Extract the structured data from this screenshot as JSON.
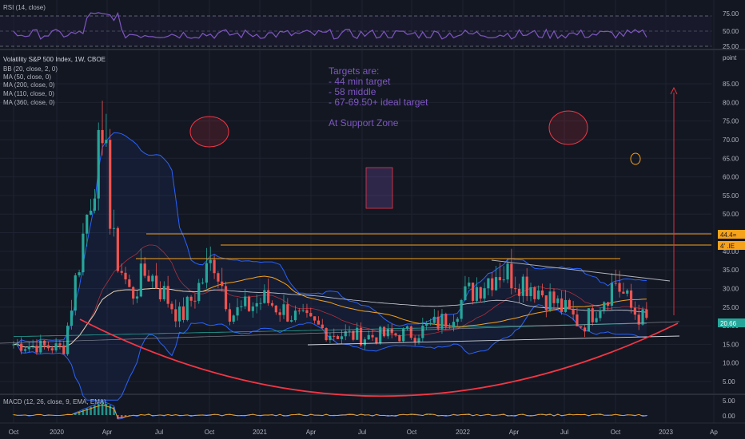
{
  "rsi_pane": {
    "label": "RSI (14, close)",
    "ticks": [
      "75.00",
      "50.00",
      "25.00"
    ]
  },
  "main_pane": {
    "title": "Volatility S&P 500 Index, 1W, CBOE",
    "indicators": [
      "BB (20, close, 2, 0)",
      "MA (50, close, 0)",
      "MA (200, close, 0)",
      "MA (110, close, 0)",
      "MA (360, close, 0)"
    ],
    "unit_label": "point",
    "price_ticks": [
      "85.00",
      "80.00",
      "75.00",
      "70.00",
      "65.00",
      "60.00",
      "55.00",
      "50.00",
      "45.00",
      "40.00",
      "35.00",
      "30.00",
      "25.00",
      "20.00",
      "15.00",
      "10.00",
      "5.00"
    ],
    "level_badges": [
      {
        "text": "44.4=",
        "color": "#f7a21b"
      },
      {
        "text": "4' .IE",
        "color": "#f7a21b"
      },
      {
        "text": "20.66",
        "color": "#26a69a"
      }
    ],
    "annotation": {
      "lines": [
        "Targets are:",
        "- 44 min target",
        "- 58 middle",
        "- 67-69.50+ ideal target",
        "",
        "At Support Zone"
      ],
      "color": "#7e57c2"
    }
  },
  "macd_pane": {
    "label": "MACD (12, 26, close, 9, EMA, EMA)",
    "ticks": [
      "5.00",
      "0.00"
    ]
  },
  "x_axis": {
    "labels": [
      "Oct",
      "2020",
      "Apr",
      "Jul",
      "Oct",
      "2021",
      "Apr",
      "Jul",
      "Oct",
      "2022",
      "Apr",
      "Jul",
      "Oct",
      "2023",
      "Ap"
    ]
  },
  "colors": {
    "background": "#131722",
    "up": "#26a69a",
    "down": "#ef5350",
    "rsi": "#7e57c2",
    "bollinger": "#2962ff",
    "ma_orange": "#f7a21b",
    "support_curve": "#f23645"
  },
  "chart_data": {
    "type": "candlestick",
    "title": "Volatility S&P 500 Index, 1W, CBOE",
    "ylabel": "point",
    "ylim": [
      0,
      88
    ],
    "x_period": [
      "2019-10",
      "2023-04"
    ],
    "horizontal_levels": [
      44.4,
      41.5,
      38
    ],
    "last_value": 20.66,
    "series_anchor_points": [
      {
        "date": "2019-10",
        "close": 15
      },
      {
        "date": "2020-01",
        "close": 14
      },
      {
        "date": "2020-02",
        "close": 40
      },
      {
        "date": "2020-03",
        "close": 66
      },
      {
        "date": "2020-04",
        "close": 41
      },
      {
        "date": "2020-05",
        "close": 28
      },
      {
        "date": "2020-06",
        "close": 35
      },
      {
        "date": "2020-08",
        "close": 22
      },
      {
        "date": "2020-10",
        "close": 38
      },
      {
        "date": "2020-11",
        "close": 23
      },
      {
        "date": "2021-01",
        "close": 27
      },
      {
        "date": "2021-03",
        "close": 22
      },
      {
        "date": "2021-05",
        "close": 18
      },
      {
        "date": "2021-07",
        "close": 17
      },
      {
        "date": "2021-10",
        "close": 18
      },
      {
        "date": "2021-12",
        "close": 22
      },
      {
        "date": "2022-01",
        "close": 28
      },
      {
        "date": "2022-03",
        "close": 35
      },
      {
        "date": "2022-05",
        "close": 31
      },
      {
        "date": "2022-07",
        "close": 24
      },
      {
        "date": "2022-08",
        "close": 20
      },
      {
        "date": "2022-10",
        "close": 32
      },
      {
        "date": "2022-11",
        "close": 24
      },
      {
        "date": "2022-12",
        "close": 20.66
      }
    ]
  }
}
